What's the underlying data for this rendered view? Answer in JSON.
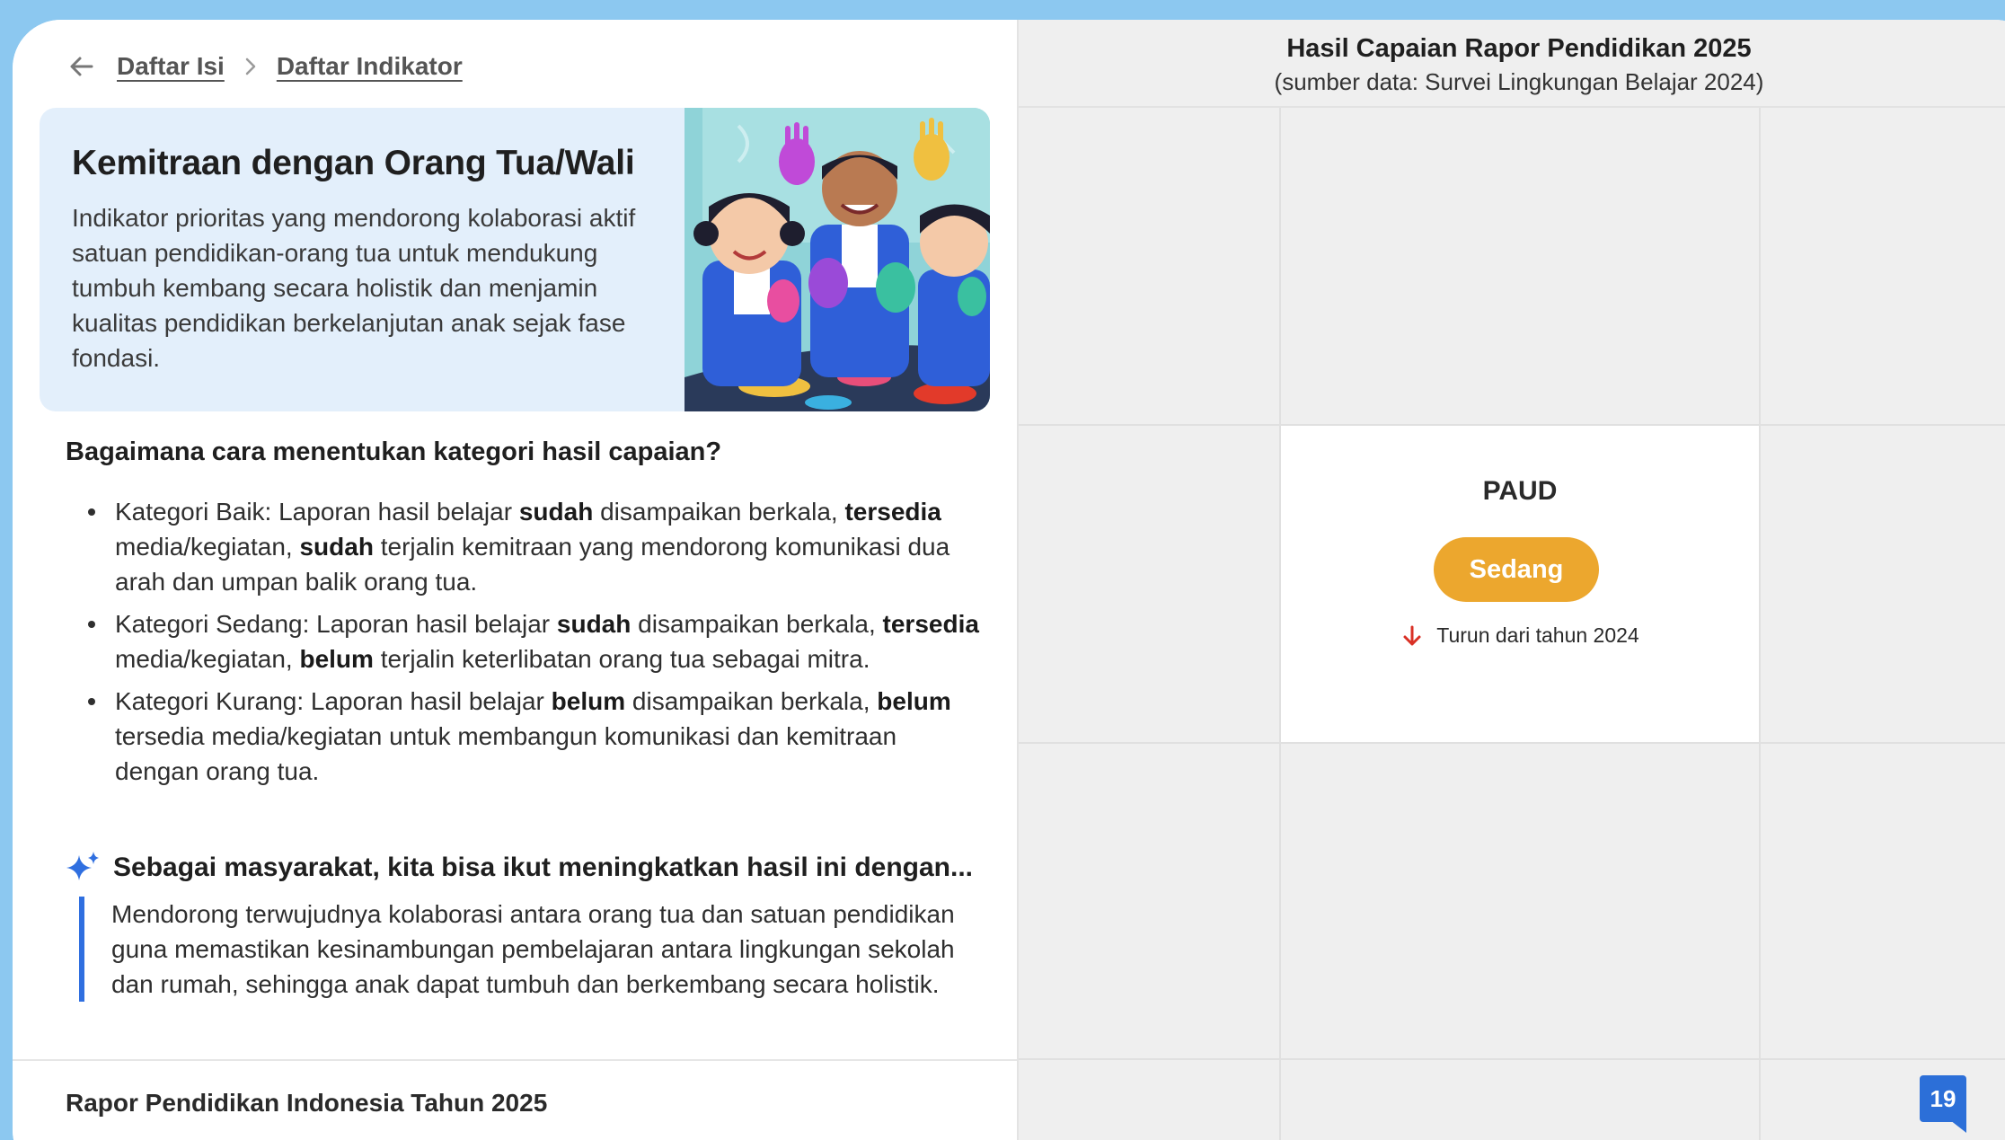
{
  "breadcrumb": {
    "items": [
      "Daftar Isi",
      "Daftar Indikator"
    ]
  },
  "hero": {
    "title": "Kemitraan dengan Orang Tua/Wali",
    "description": "Indikator prioritas yang mendorong kolaborasi aktif satuan pendidikan-orang tua untuk mendukung tumbuh kembang secara holistik dan menjamin kualitas pendidikan berkelanjutan anak sejak fase fondasi."
  },
  "category_section": {
    "question": "Bagaimana cara menentukan kategori hasil capaian?",
    "items": [
      {
        "label": "Kategori Baik",
        "parts": [
          {
            "t": "Kategori Baik: Laporan hasil belajar ",
            "b": false
          },
          {
            "t": "sudah",
            "b": true
          },
          {
            "t": " disampaikan berkala, ",
            "b": false
          },
          {
            "t": "tersedia",
            "b": true
          },
          {
            "t": " media/kegiatan, ",
            "b": false
          },
          {
            "t": "sudah",
            "b": true
          },
          {
            "t": " terjalin kemitraan yang mendorong komunikasi dua arah dan umpan balik orang tua.",
            "b": false
          }
        ]
      },
      {
        "label": "Kategori Sedang",
        "parts": [
          {
            "t": "Kategori Sedang: Laporan hasil belajar ",
            "b": false
          },
          {
            "t": "sudah",
            "b": true
          },
          {
            "t": " disampaikan berkala, ",
            "b": false
          },
          {
            "t": "tersedia",
            "b": true
          },
          {
            "t": " media/kegiatan, ",
            "b": false
          },
          {
            "t": "belum",
            "b": true
          },
          {
            "t": " terjalin keterlibatan orang tua sebagai mitra.",
            "b": false
          }
        ]
      },
      {
        "label": "Kategori Kurang",
        "parts": [
          {
            "t": "Kategori Kurang: Laporan hasil belajar ",
            "b": false
          },
          {
            "t": "belum",
            "b": true
          },
          {
            "t": " disampaikan berkala, ",
            "b": false
          },
          {
            "t": "belum",
            "b": true
          },
          {
            "t": " tersedia media/kegiatan untuk membangun komunikasi dan kemitraan dengan orang tua.",
            "b": false
          }
        ]
      }
    ]
  },
  "society": {
    "title": "Sebagai masyarakat, kita bisa ikut meningkatkan hasil ini dengan...",
    "quote": "Mendorong terwujudnya kolaborasi antara orang tua dan satuan pendidikan guna memastikan kesinambungan pembelajaran antara lingkungan sekolah dan rumah, sehingga anak dapat tumbuh dan berkembang secara holistik."
  },
  "footer": {
    "title": "Rapor Pendidikan Indonesia Tahun 2025"
  },
  "result_panel": {
    "title": "Hasil Capaian Rapor Pendidikan 2025",
    "subtitle": "(sumber data: Survei Lingkungan Belajar 2024)",
    "level": "PAUD",
    "category": "Sedang",
    "trend": "Turun dari tahun 2024"
  },
  "page_number": "19",
  "colors": {
    "hero_bg": "#e3effb",
    "badge_sedang": "#eca72e",
    "trend_down": "#d93025",
    "accent_blue": "#2f6fe0",
    "page_number_bg": "#2c6fd8"
  },
  "icons": [
    "arrow-left-icon",
    "chevron-right-icon",
    "sparkle-icon",
    "arrow-down-icon"
  ]
}
